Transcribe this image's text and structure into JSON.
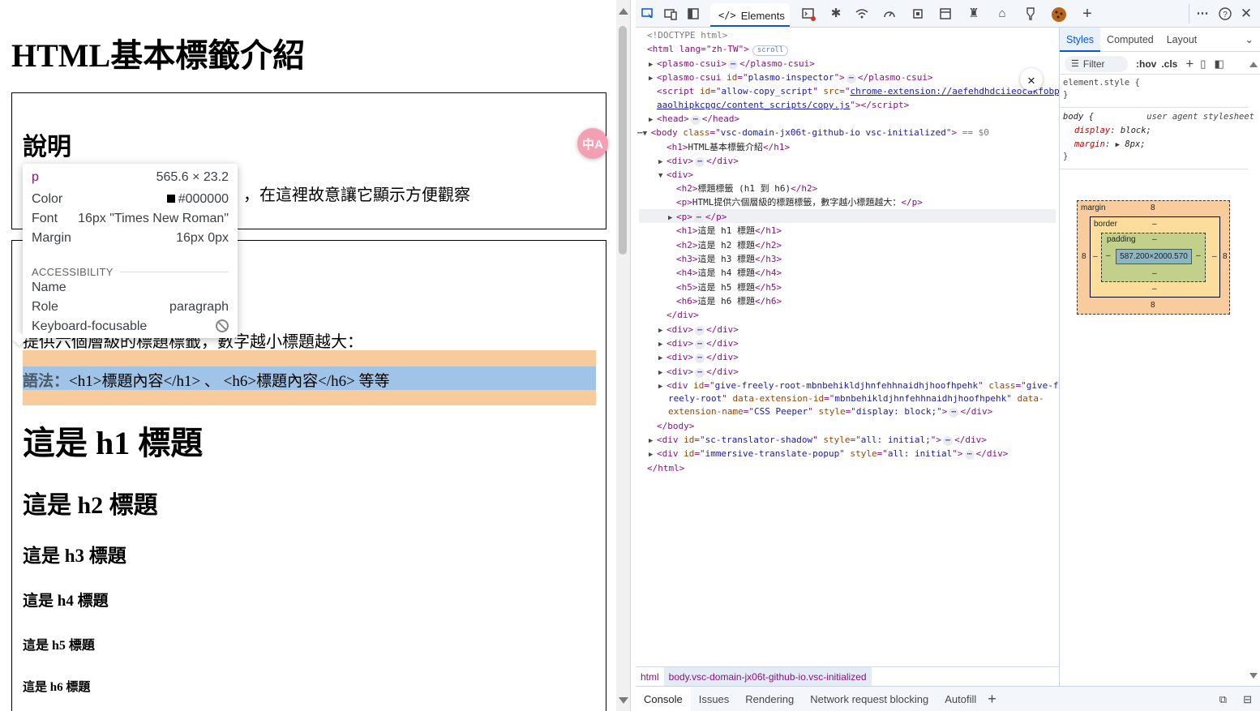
{
  "page": {
    "title_h1": "HTML基本標籤介紹",
    "desc_heading": "說明",
    "desc_text": "，在這裡故意讓它顯示方便觀察",
    "section_h2_tail": ")",
    "section_p": "提供六個層級的標題標籤，數字越小標題越大：",
    "syntax_label": "語法：",
    "syntax_code": "<h1>標題內容</h1> 、 <h6>標題內容</h6> 等等",
    "h1": "這是 h1 標題",
    "h2": "這是 h2 標題",
    "h3": "這是 h3 標題",
    "h4": "這是 h4 標題",
    "h5": "這是 h5 標題",
    "h6": "這是 h6 標題",
    "translate_badge": "中A"
  },
  "tooltip": {
    "tag": "p",
    "size": "565.6 × 23.2",
    "color_label": "Color",
    "color_value": "#000000",
    "font_label": "Font",
    "font_value": "16px \"Times New Roman\"",
    "margin_label": "Margin",
    "margin_value": "16px 0px",
    "accessibility_label": "ACCESSIBILITY",
    "name_label": "Name",
    "role_label": "Role",
    "role_value": "paragraph",
    "focus_label": "Keyboard-focusable"
  },
  "devtools": {
    "tab_elements": "Elements",
    "dom": {
      "doctype": "<!DOCTYPE html>",
      "html_open": "<html lang=\"zh-TW\">",
      "scroll_badge": "scroll",
      "plasmo1": "plasmo-csui",
      "plasmo2_id": "plasmo-inspector",
      "script_id": "allow-copy_script",
      "script_src_1": "chrome-extension://aefehdhdciieocakfobp",
      "script_src_2": "aaolhipkcpgc/content_scripts/copy.js",
      "head": "head",
      "body_class": "vsc-domain-jx06t-github-io vsc-initialized",
      "body_marker": "== $0",
      "h1_text": "HTML基本標籤介紹",
      "h2_text": "標題標籤 (h1 到 h6)",
      "p_text": "HTML提供六個層級的標題標籤，數字越小標題越大：",
      "h_items": [
        "這是 h1 標題",
        "這是 h2 標題",
        "這是 h3 標題",
        "這是 h4 標題",
        "這是 h5 標題",
        "這是 h6 標題"
      ],
      "give_freely_id": "give-freely-root-mbnbehikldjhnfehhnaidhjhoofhpehk",
      "give_freely_class": "give-freely-root",
      "give_freely_ext": "mbnbehikldjhnfehhnaidhjhoofhpehk",
      "give_freely_name": "CSS Peeper",
      "give_freely_style": "display: block;",
      "sc_id": "sc-translator-shadow",
      "sc_style": "all: initial;",
      "imm_id": "immersive-translate-popup",
      "imm_style": "all: initial"
    },
    "breadcrumbs": [
      "html",
      "body.vsc-domain-jx06t-github-io.vsc-initialized"
    ],
    "styles": {
      "tabs": [
        "Styles",
        "Computed",
        "Layout"
      ],
      "filter_placeholder": "Filter",
      "hov": ":hov",
      "cls": ".cls",
      "element_style": "element.style {",
      "brace_close": "}",
      "body_selector": "body {",
      "ua_label": "user agent stylesheet",
      "prop_display": "display",
      "val_display": "block;",
      "prop_margin": "margin",
      "val_margin": "8px;"
    },
    "box_model": {
      "margin_label": "margin",
      "margin_top": "8",
      "margin_bottom": "8",
      "margin_left": "8",
      "margin_right": "8",
      "border_label": "border",
      "border_value": "–",
      "padding_label": "padding",
      "padding_value": "–",
      "content_size": "587.200×2000.570"
    },
    "drawer_tabs": [
      "Console",
      "Issues",
      "Rendering",
      "Network request blocking",
      "Autofill"
    ]
  },
  "chart_data": {
    "type": "other"
  }
}
